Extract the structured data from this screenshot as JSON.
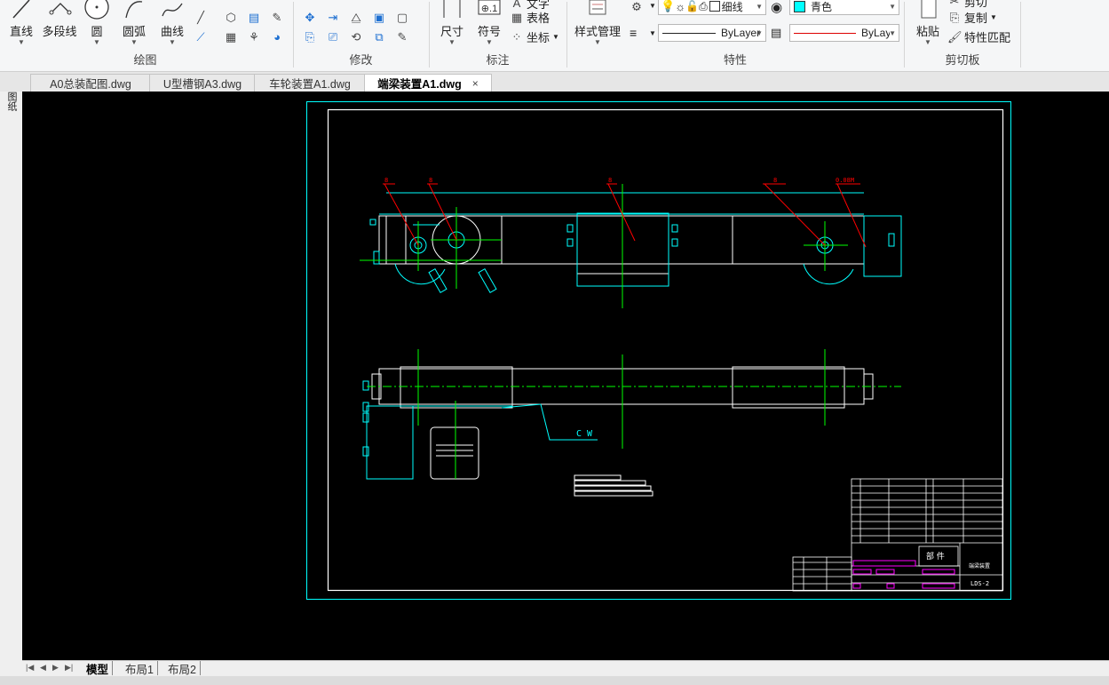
{
  "ribbon": {
    "draw": {
      "title": "绘图",
      "line": "直线",
      "polyline": "多段线",
      "circle": "圆",
      "arc": "圆弧",
      "curve": "曲线"
    },
    "modify": {
      "title": "修改"
    },
    "annotation": {
      "title": "标注",
      "dimension": "尺寸",
      "symbol": "符号",
      "text": "文字",
      "table": "表格",
      "coordinate": "坐标"
    },
    "properties": {
      "title": "特性",
      "style_manager": "样式管理",
      "lineweight": "细线",
      "color": "青色",
      "linetype": "ByLayer",
      "line_color": "ByLayer"
    },
    "clipboard": {
      "title": "剪切板",
      "paste": "粘贴",
      "cut": "剪切",
      "copy": "复制",
      "match": "特性匹配"
    }
  },
  "tabs": [
    {
      "label": "A0总装配图.dwg"
    },
    {
      "label": "U型槽钢A3.dwg"
    },
    {
      "label": "车轮装置A1.dwg"
    },
    {
      "label": "端梁装置A1.dwg"
    }
  ],
  "tab_close": "×",
  "side_label": "图纸",
  "layout_tabs": [
    "模型",
    "布局1",
    "布局2"
  ],
  "drawing": {
    "cw_label": "C W",
    "title_block_part": "部 件",
    "title_block_name": "端梁装置",
    "drawing_no": "LDS-2",
    "top_dims": [
      "8",
      "8",
      "8",
      "8",
      "0.08M"
    ]
  },
  "colors": {
    "canvas": "#000000",
    "frame": "#00ffff",
    "border": "#ffffff",
    "center": "#00ff00",
    "leader": "#ff0000",
    "magenta": "#ff00ff"
  }
}
